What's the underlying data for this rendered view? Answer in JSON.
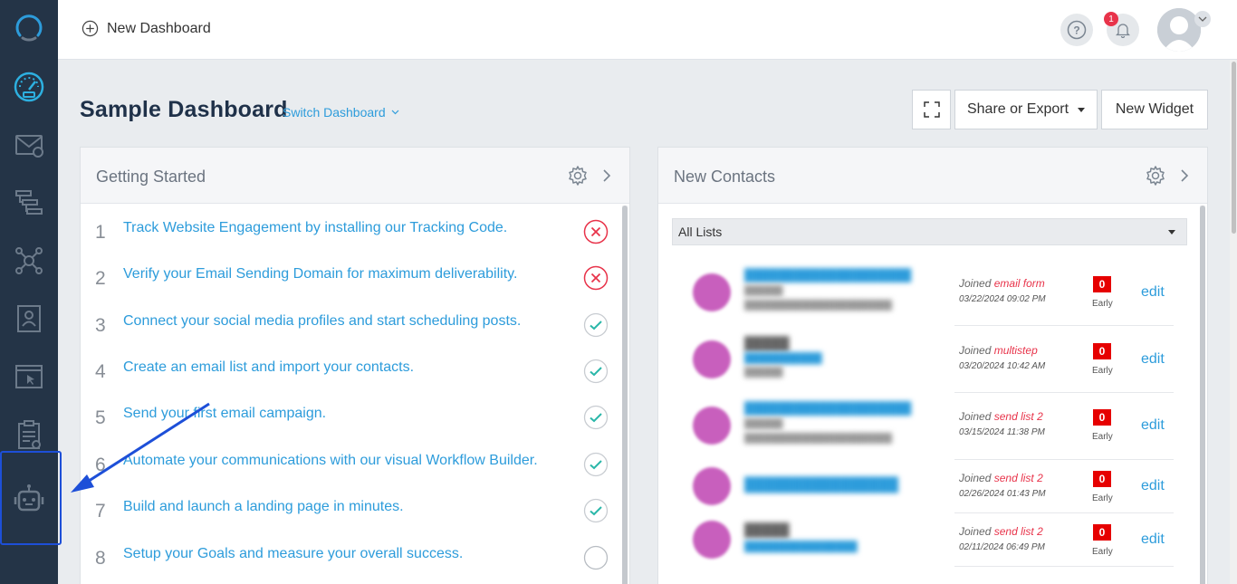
{
  "header": {
    "new_dashboard_label": "New Dashboard",
    "notification_count": "1"
  },
  "dashboard": {
    "title": "Sample Dashboard",
    "switch_label": "Switch Dashboard",
    "share_label": "Share or Export",
    "new_widget_label": "New Widget"
  },
  "getting_started": {
    "title": "Getting Started",
    "tasks": [
      {
        "num": "1",
        "text": "Track Website Engagement by installing our Tracking Code.",
        "status": "incomplete"
      },
      {
        "num": "2",
        "text": "Verify your Email Sending Domain for maximum deliverability.",
        "status": "incomplete"
      },
      {
        "num": "3",
        "text": "Connect your social media profiles and start scheduling posts.",
        "status": "complete"
      },
      {
        "num": "4",
        "text": "Create an email list and import your contacts.",
        "status": "complete"
      },
      {
        "num": "5",
        "text": "Send your first email campaign.",
        "status": "complete"
      },
      {
        "num": "6",
        "text": "Automate your communications with our visual Workflow Builder.",
        "status": "complete"
      },
      {
        "num": "7",
        "text": "Build and launch a landing page in minutes.",
        "status": "complete"
      },
      {
        "num": "8",
        "text": "Setup your Goals and measure your overall success.",
        "status": "pending"
      }
    ]
  },
  "new_contacts": {
    "title": "New Contacts",
    "list_select": "All Lists",
    "contacts": [
      {
        "joined_prefix": "Joined",
        "source": "email form",
        "date": "03/22/2024 09:02 PM",
        "score": "0",
        "score_label": "Early",
        "edit_label": "edit"
      },
      {
        "joined_prefix": "Joined",
        "source": "multistep",
        "date": "03/20/2024 10:42 AM",
        "score": "0",
        "score_label": "Early",
        "edit_label": "edit"
      },
      {
        "joined_prefix": "Joined",
        "source": "send list 2",
        "date": "03/15/2024 11:38 PM",
        "score": "0",
        "score_label": "Early",
        "edit_label": "edit"
      },
      {
        "joined_prefix": "Joined",
        "source": "send list 2",
        "date": "02/26/2024 01:43 PM",
        "score": "0",
        "score_label": "Early",
        "edit_label": "edit"
      },
      {
        "joined_prefix": "Joined",
        "source": "send list 2",
        "date": "02/11/2024 06:49 PM",
        "score": "0",
        "score_label": "Early",
        "edit_label": "edit"
      }
    ]
  },
  "colors": {
    "sidebar_bg": "#243447",
    "accent_blue": "#2d9cdb",
    "error_red": "#e8334a",
    "success_teal": "#2ab7a9",
    "annotation_blue": "#1d4fd8"
  },
  "sidebar": {
    "icons": [
      "logo-icon",
      "dashboard-gauge-icon",
      "email-icon",
      "workflow-icon",
      "network-icon",
      "contact-card-icon",
      "landing-page-icon",
      "forms-clipboard-icon",
      "chatbot-icon"
    ]
  }
}
